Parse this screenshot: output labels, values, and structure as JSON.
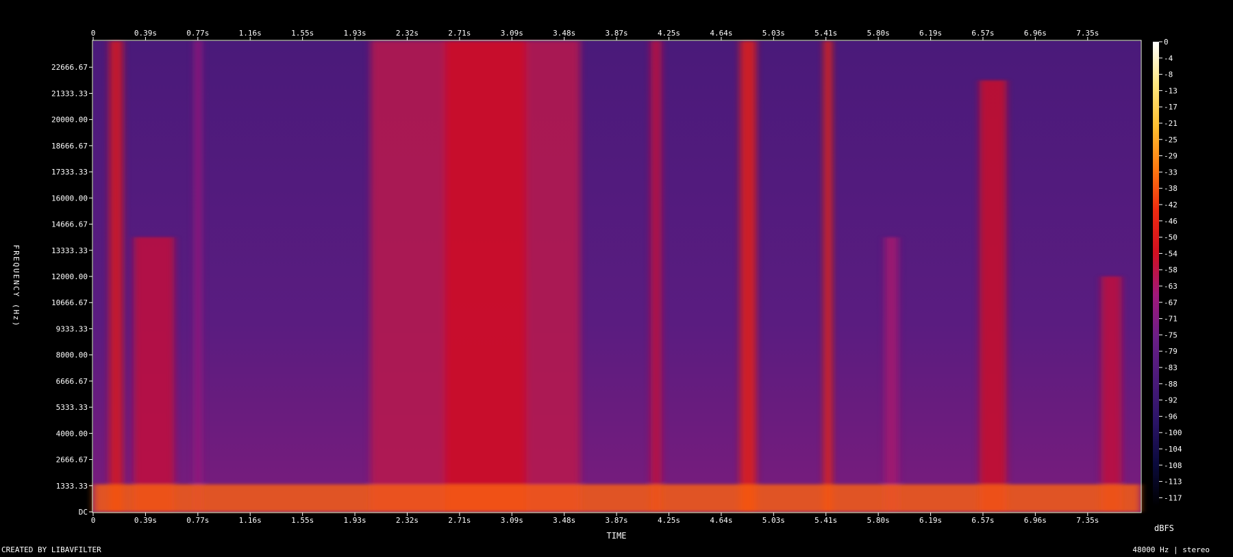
{
  "chart_data": {
    "type": "heatmap",
    "title": "",
    "xlabel": "TIME",
    "ylabel": "FREQUENCY (Hz)",
    "x_ticks": [
      "0",
      "0.39s",
      "0.77s",
      "1.16s",
      "1.55s",
      "1.93s",
      "2.32s",
      "2.71s",
      "3.09s",
      "3.48s",
      "3.87s",
      "4.25s",
      "4.64s",
      "5.03s",
      "5.41s",
      "5.80s",
      "6.19s",
      "6.57s",
      "6.96s",
      "7.35s"
    ],
    "y_ticks": [
      "DC",
      "1333.33",
      "2666.67",
      "4000.00",
      "5333.33",
      "6666.67",
      "8000.00",
      "9333.33",
      "10666.67",
      "12000.00",
      "13333.33",
      "14666.67",
      "16000.00",
      "17333.33",
      "18666.67",
      "20000.00",
      "21333.33",
      "22666.67"
    ],
    "xlim": [
      0,
      7.74
    ],
    "ylim": [
      0,
      24000
    ],
    "colorbar": {
      "unit": "dBFS",
      "ticks": [
        "0",
        "-4",
        "-8",
        "-13",
        "-17",
        "-21",
        "-25",
        "-29",
        "-33",
        "-38",
        "-42",
        "-46",
        "-50",
        "-54",
        "-58",
        "-63",
        "-67",
        "-71",
        "-75",
        "-79",
        "-83",
        "-88",
        "-92",
        "-96",
        "-100",
        "-104",
        "-108",
        "-113",
        "-117"
      ],
      "range": [
        -120,
        0
      ],
      "colors": [
        "#000000",
        "#0a0a3c",
        "#2a1466",
        "#4a1a7a",
        "#6a1e86",
        "#a0187a",
        "#d01020",
        "#ee2a10",
        "#ff7a10",
        "#ffc030",
        "#ffe880",
        "#ffffff"
      ]
    },
    "footer_left": "CREATED BY LIBAVFILTER",
    "footer_right": "48000 Hz | stereo",
    "energy_bands": [
      {
        "t0": 0.12,
        "t1": 0.22,
        "f_max": 24000,
        "level": -52
      },
      {
        "t0": 0.3,
        "t1": 0.6,
        "f_max": 14000,
        "level": -58
      },
      {
        "t0": 0.75,
        "t1": 0.8,
        "f_max": 24000,
        "level": -66
      },
      {
        "t0": 2.05,
        "t1": 3.6,
        "f_max": 24000,
        "level": -60
      },
      {
        "t0": 2.6,
        "t1": 3.2,
        "f_max": 24000,
        "level": -55
      },
      {
        "t0": 4.12,
        "t1": 4.2,
        "f_max": 24000,
        "level": -58
      },
      {
        "t0": 4.78,
        "t1": 4.9,
        "f_max": 24000,
        "level": -48
      },
      {
        "t0": 5.4,
        "t1": 5.46,
        "f_max": 24000,
        "level": -46
      },
      {
        "t0": 5.85,
        "t1": 5.95,
        "f_max": 14000,
        "level": -64
      },
      {
        "t0": 6.55,
        "t1": 6.75,
        "f_max": 22000,
        "level": -56
      },
      {
        "t0": 7.45,
        "t1": 7.6,
        "f_max": 12000,
        "level": -58
      }
    ],
    "low_freq_energy": {
      "f_max": 1400,
      "level": -36
    }
  }
}
